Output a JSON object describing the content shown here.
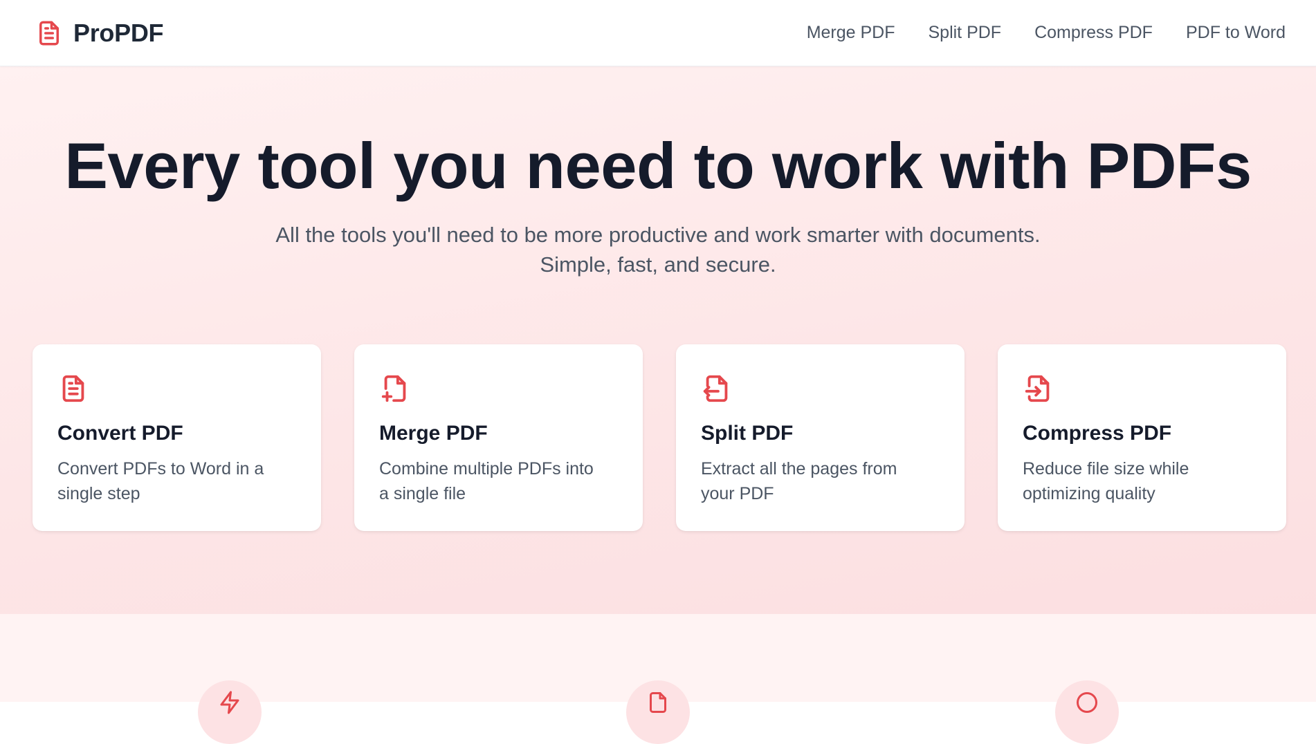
{
  "brand": {
    "name": "ProPDF",
    "icon": "file-text-icon",
    "accent_color": "#e5484d"
  },
  "nav": {
    "items": [
      {
        "label": "Merge PDF"
      },
      {
        "label": "Split PDF"
      },
      {
        "label": "Compress PDF"
      },
      {
        "label": "PDF to Word"
      }
    ]
  },
  "hero": {
    "title": "Every tool you need to work with PDFs",
    "subtitle_line1": "All the tools you'll need to be more productive and work smarter with documents.",
    "subtitle_line2": "Simple, fast, and secure."
  },
  "tools": [
    {
      "title": "Convert PDF",
      "description": "Convert PDFs to Word in a single step",
      "icon": "file-text-icon"
    },
    {
      "title": "Merge PDF",
      "description": "Combine multiple PDFs into a single file",
      "icon": "file-plus-icon"
    },
    {
      "title": "Split PDF",
      "description": "Extract all the pages from your PDF",
      "icon": "file-arrow-left-icon"
    },
    {
      "title": "Compress PDF",
      "description": "Reduce file size while optimizing quality",
      "icon": "file-arrow-right-icon"
    }
  ],
  "colors": {
    "accent": "#e5484d",
    "title": "#151b2b",
    "muted": "#4b5563",
    "hero_bg": "#fde6e7"
  }
}
